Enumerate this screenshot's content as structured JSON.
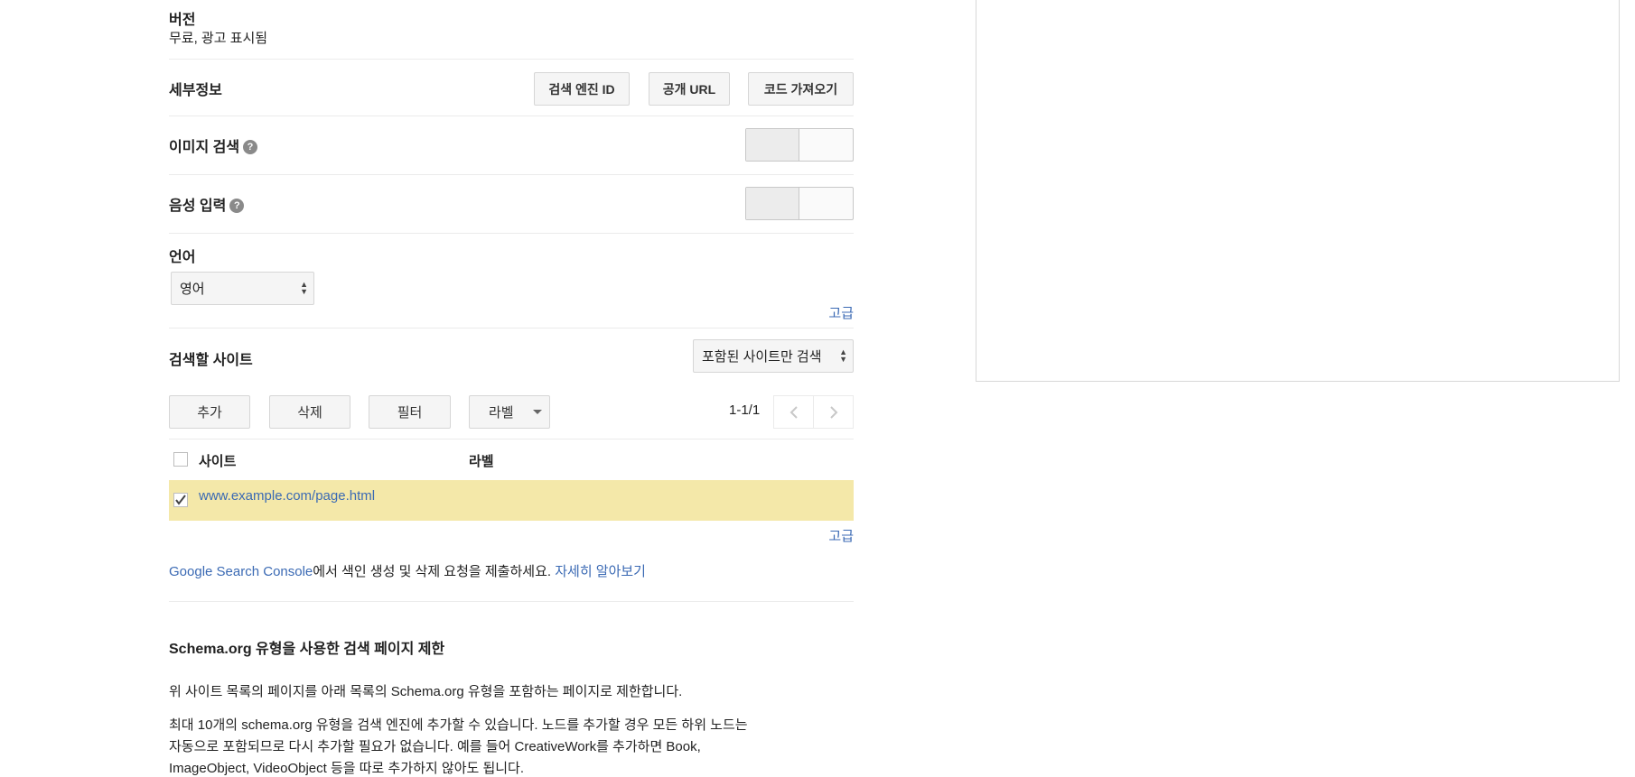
{
  "version": {
    "label": "버전",
    "value": "무료, 광고 표시됨"
  },
  "details": {
    "label": "세부정보",
    "buttons": [
      "검색 엔진 ID",
      "공개 URL",
      "코드 가져오기"
    ]
  },
  "image_search": {
    "label": "이미지 검색",
    "help": "?",
    "enabled": false
  },
  "voice_input": {
    "label": "음성 입력",
    "help": "?",
    "enabled": false
  },
  "language": {
    "label": "언어",
    "selected": "영어",
    "advanced": "고급"
  },
  "sites": {
    "label": "검색할 사이트",
    "mode_selected": "포함된 사이트만 검색",
    "toolbar": {
      "add": "추가",
      "delete": "삭제",
      "filter": "필터",
      "label": "라벨"
    },
    "pagination": "1-1/1",
    "columns": {
      "site": "사이트",
      "label": "라벨"
    },
    "rows": [
      {
        "site": "www.example.com/page.html",
        "label": "",
        "checked": true
      }
    ],
    "advanced": "고급"
  },
  "search_console_note": {
    "link": "Google Search Console",
    "text": "에서 색인 생성 및 삭제 요청을 제출하세요.",
    "learn_more": "자세히 알아보기"
  },
  "schema": {
    "heading": "Schema.org 유형을 사용한 검색 페이지 제한",
    "paragraph1": "위 사이트 목록의 페이지를 아래 목록의 Schema.org 유형을 포함하는 페이지로 제한합니다.",
    "paragraph2_line1": "최대 10개의 schema.org 유형을 검색 엔진에 추가할 수 있습니다. 노드를 추가할 경우 모든 하위 노드는",
    "paragraph2_line2": "자동으로 포함되므로 다시 추가할 필요가 없습니다. 예를 들어 CreativeWork를 추가하면 Book,",
    "paragraph2_line3": "ImageObject, VideoObject 등을 따로 추가하지 않아도 됩니다."
  },
  "icons": {
    "help": "question-circle-icon",
    "select_arrows": "up-down-arrows-icon",
    "dropdown": "caret-down-icon",
    "prev": "chevron-left-icon",
    "next": "chevron-right-icon",
    "check": "checkmark-icon"
  },
  "colors": {
    "link": "#3b6ab4",
    "selected_row": "#f4e8a9"
  }
}
